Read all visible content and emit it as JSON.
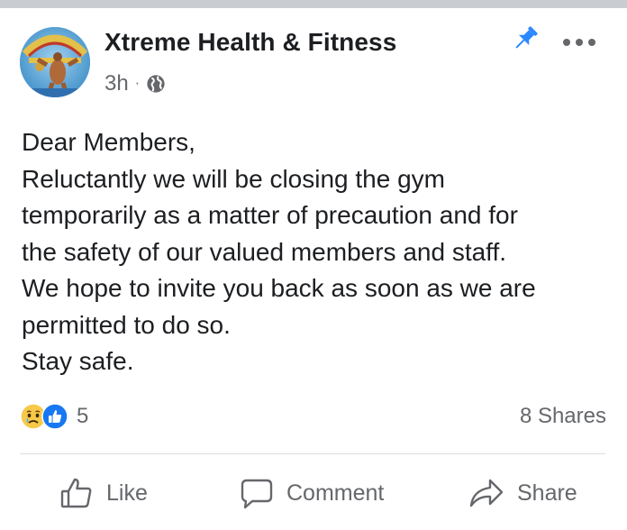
{
  "post": {
    "page_name": "Xtreme Health & Fitness",
    "time": "3h",
    "separator": "·",
    "privacy_icon": "globe-icon",
    "pinned_icon": "pin-icon",
    "more_icon": "more-options-icon",
    "body_lines": [
      "Dear Members,",
      "Reluctantly we will be closing the gym",
      "temporarily as a matter of precaution and for",
      "the safety of our valued members and staff.",
      "We hope to invite you back as soon as we are",
      "permitted to do so.",
      "Stay safe."
    ]
  },
  "engagement": {
    "reaction_icons": [
      "sad-reaction-icon",
      "like-reaction-icon"
    ],
    "reaction_count": "5",
    "shares": "8 Shares"
  },
  "actions": {
    "like": "Like",
    "comment": "Comment",
    "share": "Share"
  },
  "colors": {
    "text": "#1c1e21",
    "secondary": "#65676b",
    "like_blue": "#1877f2",
    "pin_blue": "#2d88ff",
    "divider": "#dadde1"
  }
}
